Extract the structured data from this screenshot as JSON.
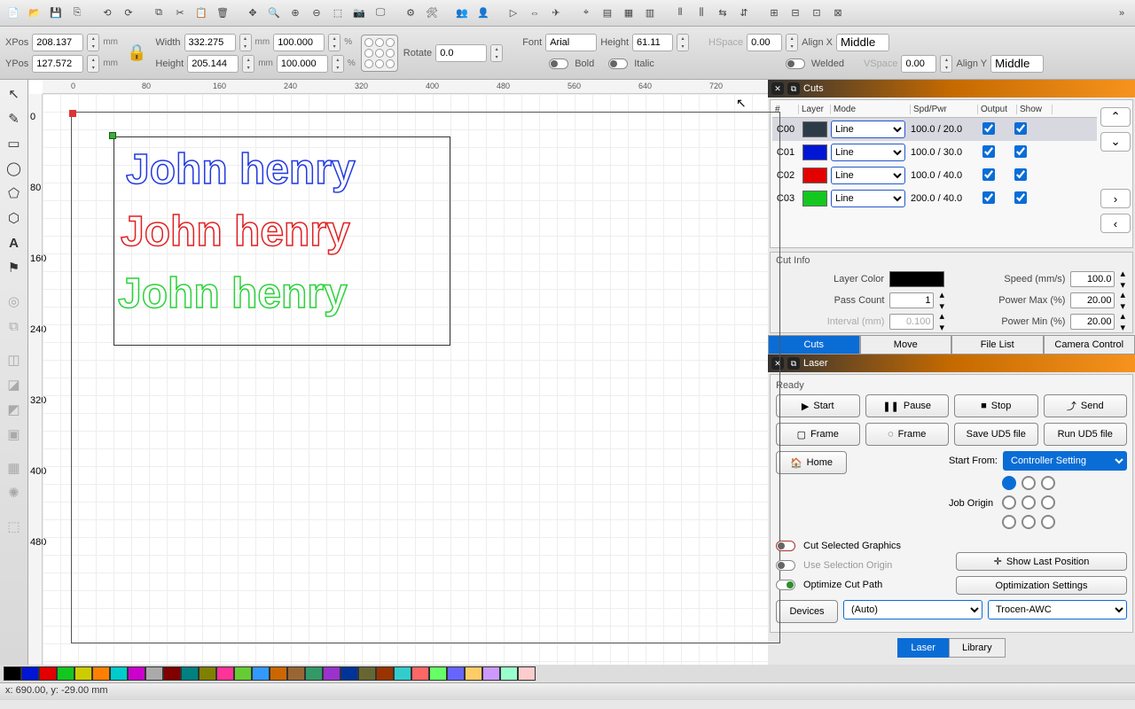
{
  "props": {
    "xpos_label": "XPos",
    "xpos": "208.137",
    "ypos_label": "YPos",
    "ypos": "127.572",
    "width_label": "Width",
    "width": "332.275",
    "height_label": "Height",
    "height": "205.144",
    "mm": "mm",
    "scale_w": "100.000",
    "scale_h": "100.000",
    "pct": "%",
    "rotate_label": "Rotate",
    "rotate": "0.0",
    "font_label": "Font",
    "font": "Arial",
    "theight_label": "Height",
    "theight": "61.11",
    "hspace_label": "HSpace",
    "hspace": "0.00",
    "vspace_label": "VSpace",
    "vspace": "0.00",
    "alignx_label": "Align X",
    "alignx": "Middle",
    "aligny_label": "Align Y",
    "aligny": "Middle",
    "bold": "Bold",
    "italic": "Italic",
    "welded": "Welded"
  },
  "ruler_h": [
    "0",
    "80",
    "160",
    "240",
    "320",
    "400",
    "480",
    "560",
    "640",
    "720"
  ],
  "ruler_v": [
    "0",
    "80",
    "160",
    "240",
    "320",
    "400",
    "480"
  ],
  "canvas_text": {
    "line1": "John henry",
    "line2": "John henry",
    "line3": "John henry",
    "colors": {
      "line1": "#2139e0",
      "line2": "#e02121",
      "line3": "#2bd23b"
    }
  },
  "cuts": {
    "title": "Cuts",
    "headers": {
      "num": "#",
      "layer": "Layer",
      "mode": "Mode",
      "spd": "Spd/Pwr",
      "output": "Output",
      "show": "Show"
    },
    "rows": [
      {
        "id": "C00",
        "color": "#2d3b48",
        "mode": "Line",
        "spd": "100.0 / 20.0",
        "out": true,
        "show": true,
        "selected": true
      },
      {
        "id": "C01",
        "color": "#0016d4",
        "mode": "Line",
        "spd": "100.0 / 30.0",
        "out": true,
        "show": true
      },
      {
        "id": "C02",
        "color": "#e20000",
        "mode": "Line",
        "spd": "100.0 / 40.0",
        "out": true,
        "show": true
      },
      {
        "id": "C03",
        "color": "#13c71f",
        "mode": "Line",
        "spd": "200.0 / 40.0",
        "out": true,
        "show": true
      }
    ]
  },
  "cutinfo": {
    "title": "Cut Info",
    "layer_color": "Layer Color",
    "speed": "Speed (mm/s)",
    "speed_v": "100.0",
    "pass": "Pass Count",
    "pass_v": "1",
    "interval": "Interval (mm)",
    "interval_v": "0.100",
    "pmax": "Power Max (%)",
    "pmax_v": "20.00",
    "pmin": "Power Min (%)",
    "pmin_v": "20.00"
  },
  "ctabs": {
    "cuts": "Cuts",
    "move": "Move",
    "file": "File List",
    "camera": "Camera Control"
  },
  "laser": {
    "title": "Laser",
    "ready": "Ready",
    "start": "Start",
    "pause": "Pause",
    "stop": "Stop",
    "send": "Send",
    "frame1": "Frame",
    "frame2": "Frame",
    "save": "Save UD5 file",
    "run": "Run UD5 file",
    "home": "Home",
    "startfrom": "Start From:",
    "startfrom_v": "Controller Setting",
    "joborigin": "Job Origin",
    "cutsel": "Cut Selected Graphics",
    "useorigin": "Use Selection Origin",
    "optimize": "Optimize Cut Path",
    "showlast": "Show Last Position",
    "optset": "Optimization Settings",
    "devices": "Devices",
    "auto": "(Auto)",
    "controller": "Trocen-AWC"
  },
  "btabs": {
    "laser": "Laser",
    "library": "Library"
  },
  "palette": [
    "#000000",
    "#0016d4",
    "#e20000",
    "#13c71f",
    "#cccc00",
    "#ff8000",
    "#00cccc",
    "#cc00cc",
    "#aaaaaa",
    "#800000",
    "#008080",
    "#808000",
    "#ff3399",
    "#66cc33",
    "#3399ff",
    "#cc6600",
    "#996633",
    "#339966",
    "#9933cc",
    "#003399",
    "#666633",
    "#993300",
    "#33cccc",
    "#ff6666",
    "#66ff66",
    "#6666ff",
    "#ffcc66",
    "#cc99ff",
    "#99ffcc",
    "#ffcccc"
  ],
  "status": "x: 690.00, y: -29.00 mm"
}
